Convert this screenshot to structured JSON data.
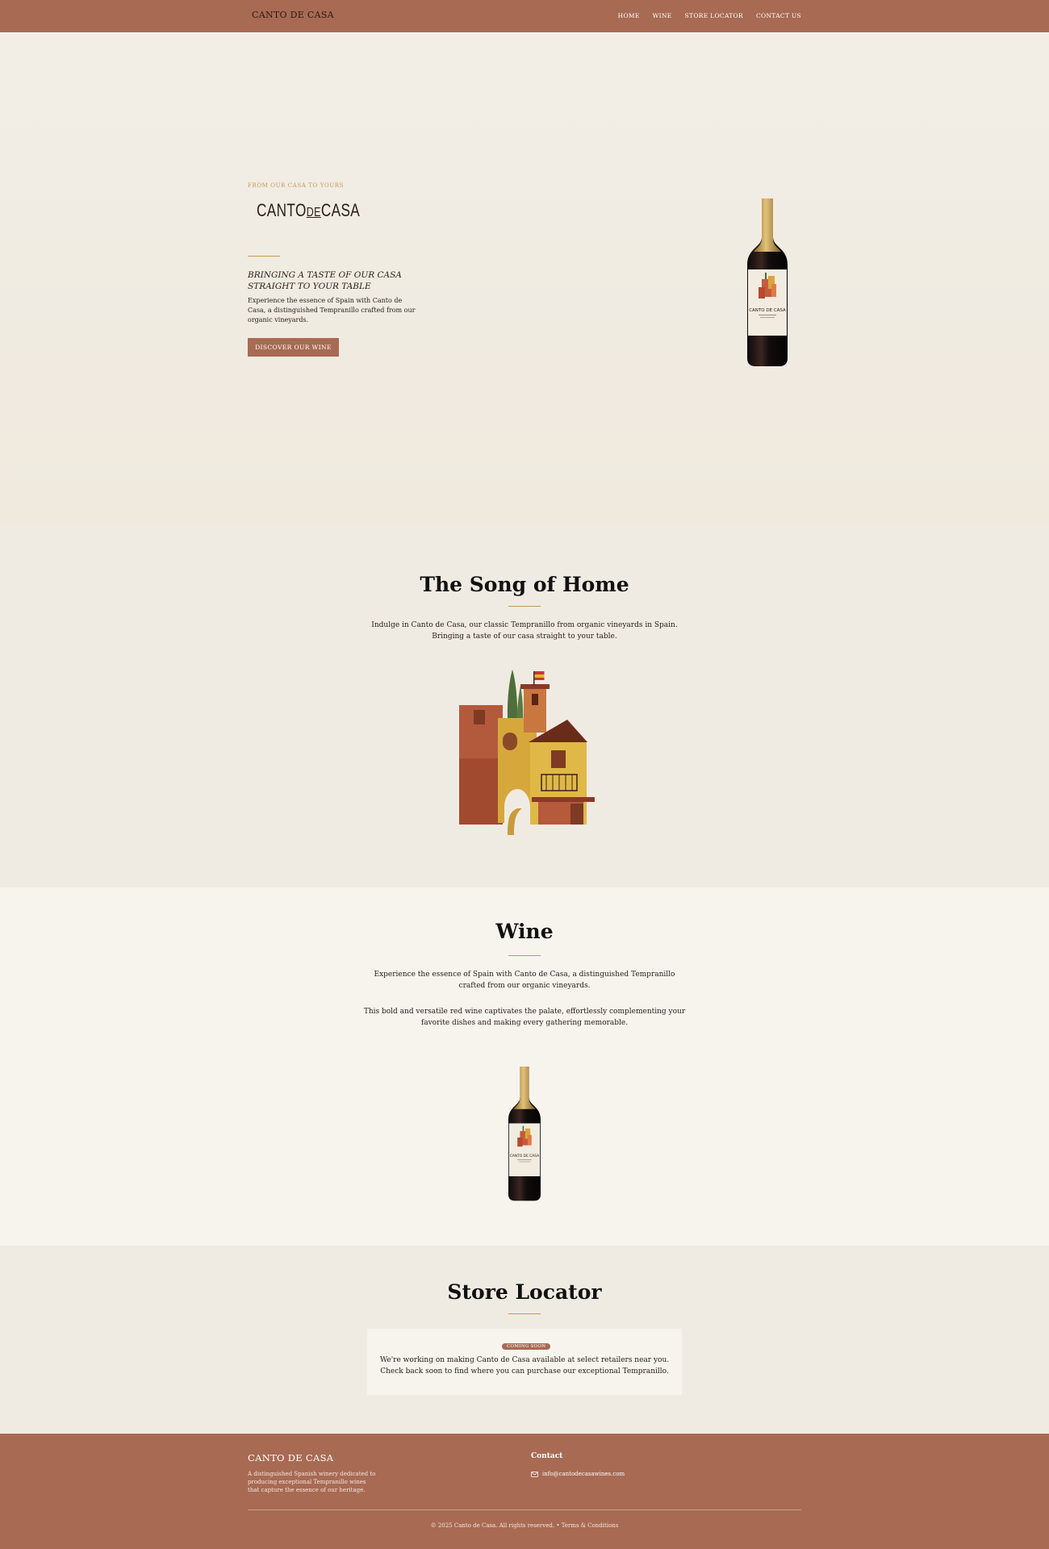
{
  "nav": {
    "logo": "CANTO DE CASA",
    "links": [
      "HOME",
      "WINE",
      "STORE LOCATOR",
      "CONTACT US"
    ]
  },
  "hero": {
    "eyebrow": "FROM OUR CASA TO YOURS",
    "brand_left": "CANTO",
    "brand_mid": "DE",
    "brand_right": "CASA",
    "tagline": "BRINGING A TASTE OF OUR CASA STRAIGHT TO YOUR TABLE",
    "description": "Experience the essence of Spain with Canto de Casa, a distinguished Tempranillo crafted from our organic vineyards.",
    "cta": "DISCOVER OUR WINE",
    "bottle_label": "CANTO DE CASA"
  },
  "song": {
    "title": "The Song of Home",
    "text": "Indulge in Canto de Casa, our classic Tempranillo from organic vineyards in Spain. Bringing a taste of our casa straight to your table."
  },
  "wine": {
    "title": "Wine",
    "text1": "Experience the essence of Spain with Canto de Casa, a distinguished Tempranillo crafted from our organic vineyards.",
    "text2": "This bold and versatile red wine captivates the palate, effortlessly complementing your favorite dishes and making every gathering memorable.",
    "bottle_label": "CANTO DE CASA"
  },
  "store": {
    "title": "Store Locator",
    "badge": "COMING SOON",
    "text": "We're working on making Canto de Casa available at select retailers near you. Check back soon to find where you can purchase our exceptional Tempranillo."
  },
  "footer": {
    "brand": "CANTO DE CASA",
    "description": "A distinguished Spanish winery dedicated to producing exceptional Tempranillo wines that capture the essence of our heritage.",
    "contact_heading": "Contact",
    "email": "info@cantodecasawines.com",
    "copyright": "© 2025 Canto de Casa. All rights reserved.",
    "separator": "•",
    "terms": "Terms & Conditions"
  },
  "colors": {
    "accent": "#a86a53",
    "gold": "#c49a54",
    "background": "#f0ebe2",
    "background_light": "#f7f4ee"
  }
}
